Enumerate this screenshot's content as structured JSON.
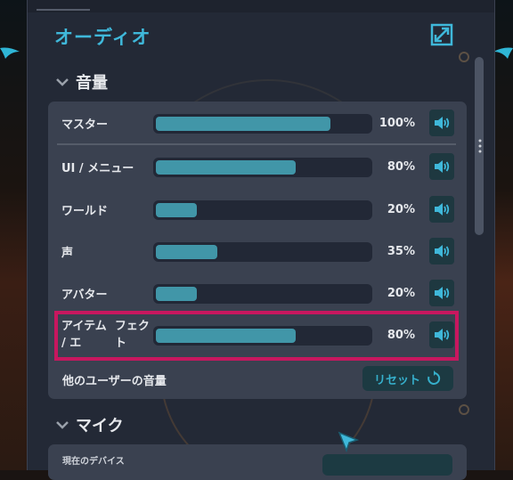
{
  "panel": {
    "title": "オーディオ"
  },
  "volume_section": {
    "header": "音量",
    "rows": [
      {
        "label": "マスター",
        "percent": "100%",
        "level": 1.0
      },
      {
        "label": "UI / メニュー",
        "percent": "80%",
        "level": 0.8
      },
      {
        "label": "ワールド",
        "percent": "20%",
        "level": 0.2
      },
      {
        "label": "声",
        "percent": "35%",
        "level": 0.35
      },
      {
        "label": "アバター",
        "percent": "20%",
        "level": 0.2
      },
      {
        "label": "アイテム / エフェクト",
        "label_line1": "アイテム / エ",
        "label_line2": "フェクト",
        "percent": "80%",
        "level": 0.8
      }
    ],
    "others_label": "他のユーザーの音量",
    "reset_label": "リセット"
  },
  "mic_section": {
    "header": "マイク",
    "current_device_label": "現在のデバイス"
  },
  "colors": {
    "accent": "#3fb8da",
    "bar_fill": "#4196a8",
    "highlight": "#c8175f",
    "panel_bg": "#232936",
    "card_bg": "#3a4150"
  },
  "icons": [
    "expand-icon",
    "chevron-down-icon",
    "speaker-icon",
    "reset-icon",
    "cursor-icon"
  ]
}
